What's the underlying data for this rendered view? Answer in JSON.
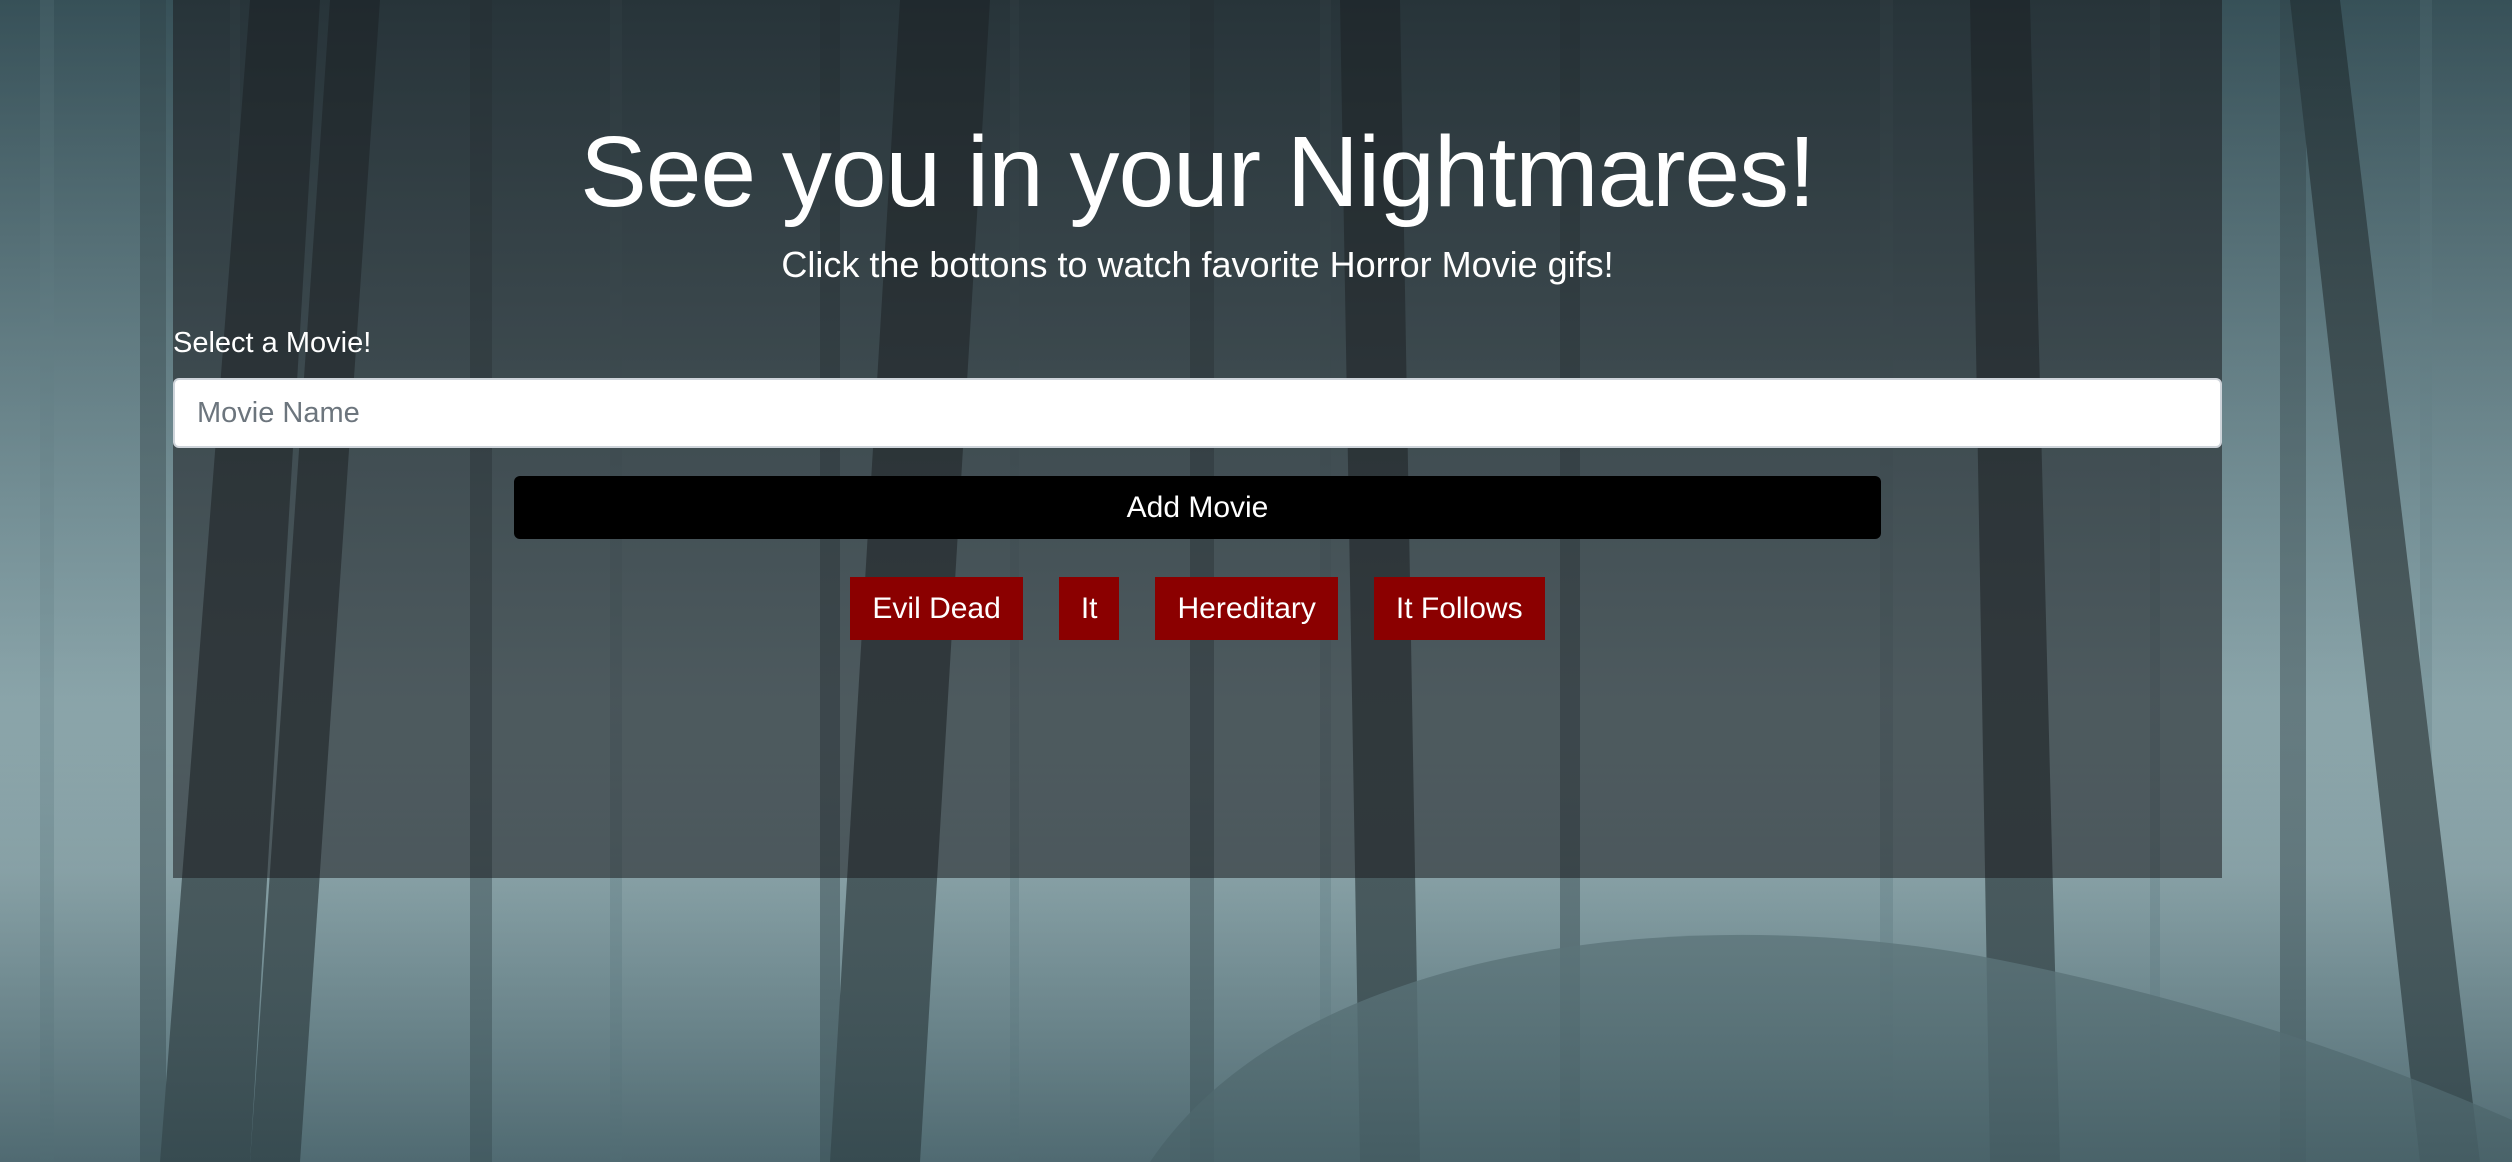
{
  "hero": {
    "title": "See you in your Nightmares!",
    "subtitle": "Click the bottons to watch favorite Horror Movie gifs!"
  },
  "form": {
    "label": "Select a Movie!",
    "input_value": "",
    "input_placeholder": "Movie Name",
    "add_button_label": "Add Movie"
  },
  "movies": [
    {
      "label": "Evil Dead"
    },
    {
      "label": "It"
    },
    {
      "label": "Hereditary"
    },
    {
      "label": "It Follows"
    }
  ],
  "colors": {
    "movie_button_bg": "#8b0000",
    "add_button_bg": "#000000",
    "panel_bg": "rgba(28,30,33,0.55)"
  }
}
